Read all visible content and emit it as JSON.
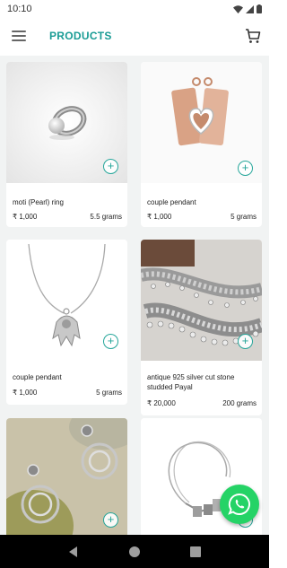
{
  "status": {
    "time": "10:10"
  },
  "header": {
    "title": "PRODUCTS",
    "menu_icon": "hamburger-menu-icon",
    "cart_icon": "cart-icon"
  },
  "products": [
    {
      "name": "moti (Pearl) ring",
      "price": "₹ 1,000",
      "weight": "5.5 grams",
      "add_label": "+"
    },
    {
      "name": "couple pendant",
      "price": "₹ 1,000",
      "weight": "5 grams",
      "add_label": "+"
    },
    {
      "name": "couple pendant",
      "price": "₹ 1,000",
      "weight": "5 grams",
      "add_label": "+"
    },
    {
      "name": "antique 925 silver cut stone studded Payal",
      "price": "₹ 20,000",
      "weight": "200 grams",
      "add_label": "+"
    },
    {
      "name": "",
      "price": "",
      "weight": "",
      "add_label": "+"
    },
    {
      "name": "",
      "price": "",
      "weight": "",
      "add_label": "+"
    }
  ],
  "colors": {
    "accent": "#1a9c95",
    "whatsapp": "#25d366",
    "background": "#f1f3f3"
  }
}
